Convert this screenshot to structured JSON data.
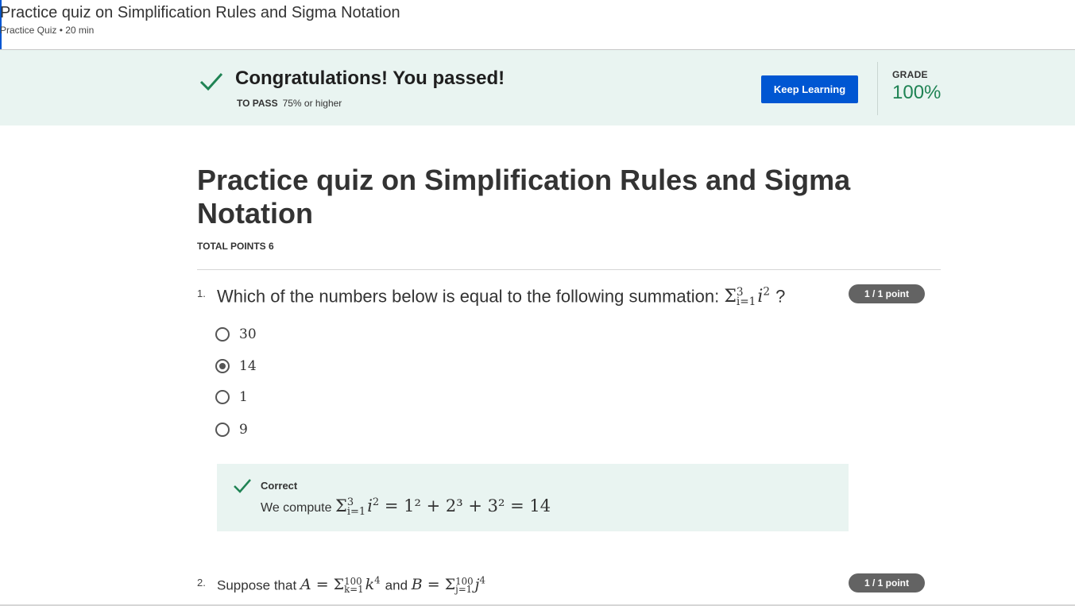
{
  "header": {
    "title": "Practice quiz on Simplification Rules and Sigma Notation",
    "meta": "Practice Quiz • 20 min"
  },
  "banner": {
    "headline": "Congratulations! You passed!",
    "to_pass_label": "TO PASS",
    "to_pass_value": "75% or higher",
    "keep_learning_label": "Keep Learning",
    "grade_label": "GRADE",
    "grade_value": "100%",
    "check_color": "#1f8354",
    "button_color": "#0056d2"
  },
  "quiz": {
    "title": "Practice quiz on Simplification Rules and Sigma Notation",
    "total_points": "TOTAL POINTS 6"
  },
  "questions": [
    {
      "number": "1.",
      "text": "Which of the numbers below is equal to the following summation:",
      "math": {
        "sigma": "Σ",
        "upper": "3",
        "lower": "i=1",
        "var": "i",
        "exp": "2"
      },
      "after": "?",
      "points": "1 / 1 point",
      "options": [
        {
          "label": "30",
          "selected": false
        },
        {
          "label": "14",
          "selected": true
        },
        {
          "label": "1",
          "selected": false
        },
        {
          "label": "9",
          "selected": false
        }
      ],
      "feedback": {
        "status": "Correct",
        "text": "We compute",
        "expression": "= 1² + 2³ + 3² = 14"
      }
    },
    {
      "number": "2.",
      "text_start": "Suppose that",
      "A_expr": {
        "lhs": "A",
        "upper": "100",
        "lower": "k=1",
        "var": "k",
        "exp": "4"
      },
      "and_word": "and",
      "B_expr": {
        "lhs": "B",
        "upper": "100",
        "lower": "j=1",
        "var": "j",
        "exp": "4"
      },
      "points": "1 / 1 point"
    }
  ]
}
